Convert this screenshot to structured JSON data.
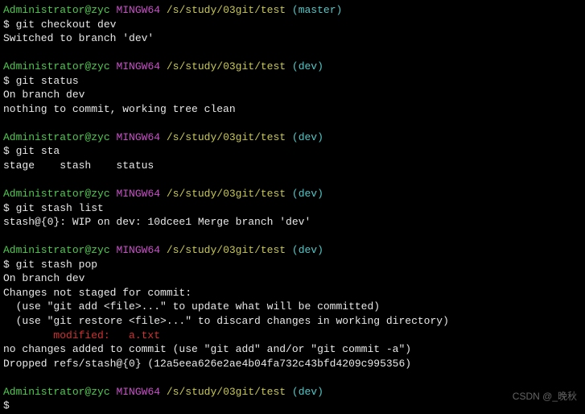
{
  "prompt": {
    "user": "Administrator@zyc",
    "host": "MINGW64",
    "path": "/s/study/03git/test",
    "branch_master": "(master)",
    "branch_dev": "(dev)",
    "sigil": "$"
  },
  "blocks": [
    {
      "cmd": "git checkout dev",
      "branch": "master",
      "out": [
        "Switched to branch 'dev'"
      ]
    },
    {
      "cmd": "git status",
      "branch": "dev",
      "out": [
        "On branch dev",
        "nothing to commit, working tree clean"
      ]
    },
    {
      "cmd": "git sta",
      "branch": "dev",
      "out": [
        "stage    stash    status"
      ]
    },
    {
      "cmd": "git stash list",
      "branch": "dev",
      "out": [
        "stash@{0}: WIP on dev: 10dcee1 Merge branch 'dev'"
      ]
    },
    {
      "cmd": "git stash pop",
      "branch": "dev",
      "out_pre": [
        "On branch dev",
        "Changes not staged for commit:",
        "  (use \"git add <file>...\" to update what will be committed)",
        "  (use \"git restore <file>...\" to discard changes in working directory)"
      ],
      "modified": "        modified:   a.txt",
      "out_post": [
        "",
        "no changes added to commit (use \"git add\" and/or \"git commit -a\")",
        "Dropped refs/stash@{0} (12a5eea626e2ae4b04fa732c43bfd4209c995356)"
      ]
    }
  ],
  "final_prompt_branch": "dev",
  "watermark": "CSDN @_晚秋"
}
